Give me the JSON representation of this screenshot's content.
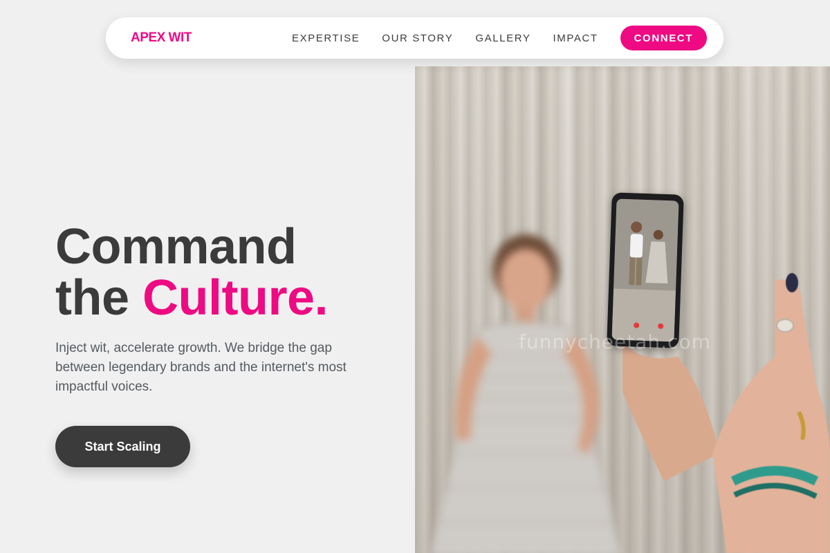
{
  "nav": {
    "logo": "APEX WIT",
    "links": [
      "EXPERTISE",
      "OUR STORY",
      "GALLERY",
      "IMPACT"
    ],
    "cta_label": "CONNECT"
  },
  "hero": {
    "headline_line1": "Command",
    "headline_line2_prefix": "the ",
    "headline_accent": "Culture.",
    "subtext": "Inject wit, accelerate growth. We bridge the gap between legendary brands and the internet's most impactful voices.",
    "cta_label": "Start Scaling"
  },
  "image": {
    "watermark": "funnycheetah.com",
    "description_icon": "photo-woman-filming-video"
  },
  "colors": {
    "accent": "#ee0a82",
    "dark": "#3b3b3b",
    "background": "#f0f0f0"
  }
}
